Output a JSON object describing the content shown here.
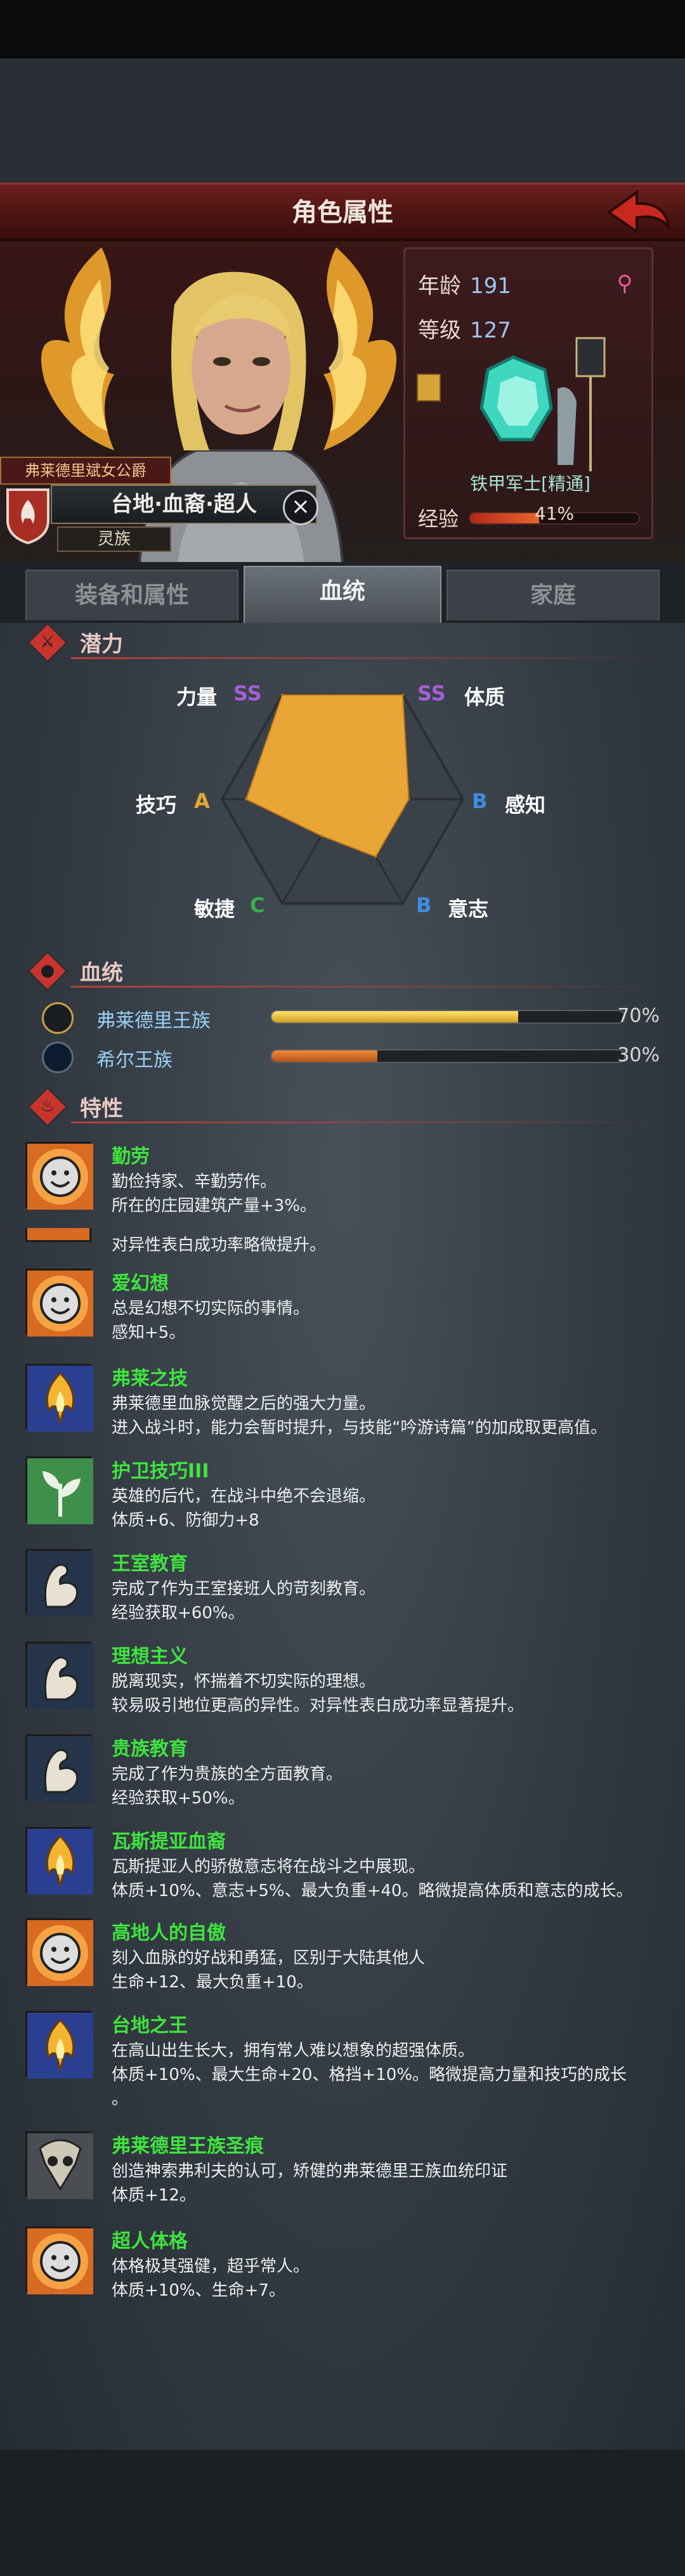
{
  "header": {
    "title": "角色属性",
    "back_icon": "back-arrow-icon"
  },
  "hero": {
    "title_strip": "弗莱德里斌女公爵",
    "name": "台地·血裔·超人",
    "race": "灵族"
  },
  "stats": {
    "age_label": "年龄",
    "age_value": "191",
    "level_label": "等级",
    "level_value": "127",
    "class_name": "铁甲军士[精通]",
    "exp_label": "经验",
    "exp_text": "41%",
    "exp_fraction": 0.41
  },
  "tabs": [
    {
      "label": "装备和属性"
    },
    {
      "label": "血统"
    },
    {
      "label": "家庭"
    }
  ],
  "potential": {
    "title": "潜力",
    "labels": {
      "strength": "力量",
      "constitution": "体质",
      "perception": "感知",
      "will": "意志",
      "agility": "敏捷",
      "skill": "技巧"
    },
    "grades": {
      "strength": "SS",
      "constitution": "SS",
      "perception": "B",
      "will": "B",
      "agility": "C",
      "skill": "A"
    }
  },
  "chart_data": {
    "type": "radar",
    "axes": [
      "力量",
      "体质",
      "感知",
      "意志",
      "敏捷",
      "技巧"
    ],
    "grades": [
      "SS",
      "SS",
      "B",
      "B",
      "C",
      "A"
    ]
  },
  "bloodline": {
    "title": "血统",
    "items": [
      {
        "name": "弗莱德里王族",
        "percent_text": "70%",
        "value": 0.7
      },
      {
        "name": "希尔王族",
        "percent_text": "30%",
        "value": 0.3
      }
    ]
  },
  "traits": {
    "title": "特性",
    "items": [
      {
        "name": "勤劳",
        "lines": [
          "勤俭持家、辛勤劳作。",
          "所在的庄园建筑产量+3%。"
        ]
      },
      {
        "name": "",
        "lines": [
          "对异性表白成功率略微提升。"
        ]
      },
      {
        "name": "爱幻想",
        "lines": [
          "总是幻想不切实际的事情。",
          "感知+5。"
        ]
      },
      {
        "name": "弗莱之技",
        "lines": [
          "弗莱德里血脉觉醒之后的强大力量。",
          "进入战斗时，能力会暂时提升，与技能“吟游诗篇”的加成取更高值。"
        ]
      },
      {
        "name": "护卫技巧III",
        "lines": [
          "英雄的后代，在战斗中绝不会退缩。",
          "体质+6、防御力+8"
        ]
      },
      {
        "name": "王室教育",
        "lines": [
          "完成了作为王室接班人的苛刻教育。",
          "经验获取+60%。"
        ]
      },
      {
        "name": "理想主义",
        "lines": [
          "脱离现实，怀揣着不切实际的理想。",
          "较易吸引地位更高的异性。对异性表白成功率显著提升。"
        ]
      },
      {
        "name": "贵族教育",
        "lines": [
          "完成了作为贵族的全方面教育。",
          "经验获取+50%。"
        ]
      },
      {
        "name": "瓦斯提亚血裔",
        "lines": [
          "瓦斯提亚人的骄傲意志将在战斗之中展现。",
          "体质+10%、意志+5%、最大负重+40。略微提高体质和意志的成长。"
        ]
      },
      {
        "name": "高地人的自傲",
        "lines": [
          "刻入血脉的好战和勇猛，区别于大陆其他人",
          "生命+12、最大负重+10。"
        ]
      },
      {
        "name": "台地之王",
        "lines": [
          "在高山出生长大，拥有常人难以想象的超强体质。",
          "体质+10%、最大生命+20、格挡+10%。略微提高力量和技巧的成长",
          "。"
        ]
      },
      {
        "name": "弗莱德里王族圣痕",
        "lines": [
          "创造神索弗利夫的认可，矫健的弗莱德里王族血统印证",
          "体质+12。"
        ]
      },
      {
        "name": "超人体格",
        "lines": [
          "体格极其强健，超乎常人。",
          "体质+10%、生命+7。"
        ]
      }
    ]
  }
}
